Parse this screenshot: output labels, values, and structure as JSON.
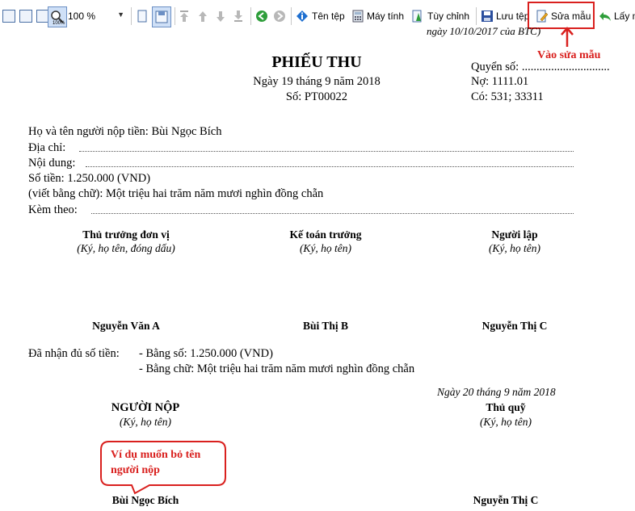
{
  "toolbar": {
    "zoom_value": "100 %",
    "ten_tep": "Tên tệp",
    "may_tinh": "Máy tính",
    "tuy_chinh": "Tùy chỉnh",
    "luu_tep": "Lưu tệp",
    "sua_mau": "Sửa mẫu",
    "lay_mau": "Lấy m",
    "zoom_badge": "100%"
  },
  "header_note": "ngày 10/10/2017 của BTC)",
  "annotations": {
    "edit_template": "Vào sửa mẫu",
    "bubble_line1": "Ví dụ muốn bỏ tên",
    "bubble_line2": "người nộp",
    "accent": "#d9201e"
  },
  "receipt": {
    "title": "PHIẾU THU",
    "date": "Ngày 19 tháng 9 năm 2018",
    "number": "Số: PT00022",
    "book_no": "Quyển số: ..............................",
    "debit": "Nợ: 1111.01",
    "credit": "Có: 531; 33311",
    "payer_line": "Họ và tên người nộp tiền: Bùi Ngọc Bích",
    "address_label": "Địa chỉ:",
    "content_label": "Nội dung:",
    "amount": "Số tiền: 1.250.000 (VND)",
    "amount_words": "(viết bằng chữ): Một triệu hai trăm năm mươi nghìn đồng chẵn",
    "attached_label": "Kèm theo:"
  },
  "signatures": {
    "director_title": "Thủ trưởng đơn vị",
    "director_note": "(Ký, họ tên, đóng dấu)",
    "director_name": "Nguyễn Văn A",
    "accountant_title": "Kế toán trưởng",
    "accountant_note": "(Ký, họ tên)",
    "accountant_name": "Bùi Thị B",
    "preparer_title": "Người lập",
    "preparer_note": "(Ký, họ tên)",
    "preparer_name": "Nguyễn Thị C"
  },
  "received": {
    "label": "Đã nhận đủ số tiền:",
    "by_number": "- Bằng số: 1.250.000 (VND)",
    "by_words": "- Bằng chữ: Một triệu hai trăm năm mươi nghìn đồng chẵn"
  },
  "footer": {
    "date": "Ngày 20 tháng 9 năm 2018",
    "payer_title": "NGƯỜI NỘP",
    "payer_note": "(Ký, họ tên)",
    "payer_name": "Bùi Ngọc Bích",
    "cashier_title": "Thủ quỹ",
    "cashier_note": "(Ký, họ tên)",
    "cashier_name": "Nguyễn Thị C"
  }
}
